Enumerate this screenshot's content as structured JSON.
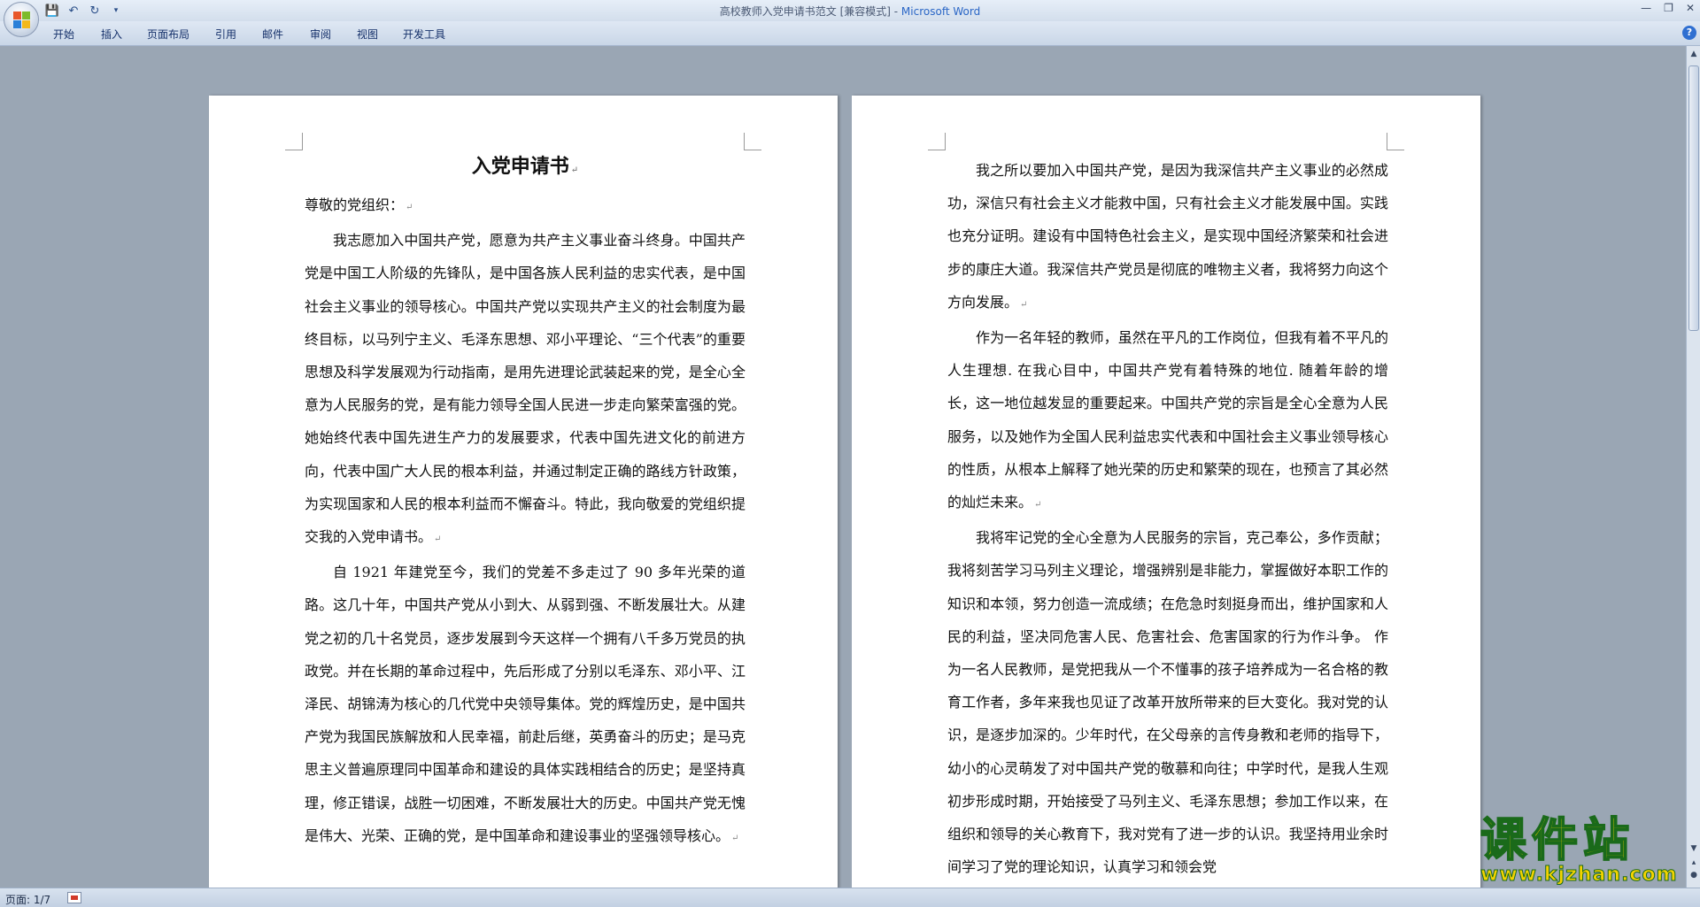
{
  "window": {
    "title": "高校教师入党申请书范文 [兼容模式] - ",
    "app_name": "Microsoft Word"
  },
  "quick_access": {
    "icons": [
      "save-icon",
      "undo-icon",
      "redo-icon",
      "customize-icon"
    ]
  },
  "ribbon_tabs": [
    "开始",
    "插入",
    "页面布局",
    "引用",
    "邮件",
    "审阅",
    "视图",
    "开发工具"
  ],
  "document": {
    "left_page": {
      "title": "入党申请书",
      "salutation": "尊敬的党组织：",
      "paragraphs": [
        "我志愿加入中国共产党，愿意为共产主义事业奋斗终身。中国共产党是中国工人阶级的先锋队，是中国各族人民利益的忠实代表，是中国社会主义事业的领导核心。中国共产党以实现共产主义的社会制度为最终目标，以马列宁主义、毛泽东思想、邓小平理论、“三个代表”的重要思想及科学发展观为行动指南，是用先进理论武装起来的党，是全心全意为人民服务的党，是有能力领导全国人民进一步走向繁荣富强的党。她始终代表中国先进生产力的发展要求，代表中国先进文化的前进方向，代表中国广大人民的根本利益，并通过制定正确的路线方针政策，为实现国家和人民的根本利益而不懈奋斗。特此，我向敬爱的党组织提交我的入党申请书。",
        "自 1921 年建党至今，我们的党差不多走过了 90 多年光荣的道路。这几十年，中国共产党从小到大、从弱到强、不断发展壮大。从建党之初的几十名党员，逐步发展到今天这样一个拥有八千多万党员的执政党。并在长期的革命过程中，先后形成了分别以毛泽东、邓小平、江泽民、胡锦涛为核心的几代党中央领导集体。党的辉煌历史，是中国共产党为我国民族解放和人民幸福，前赴后继，英勇奋斗的历史；是马克思主义普遍原理同中国革命和建设的具体实践相结合的历史；是坚持真理，修正错误，战胜一切困难，不断发展壮大的历史。中国共产党无愧是伟大、光荣、正确的党，是中国革命和建设事业的坚强领导核心。"
      ]
    },
    "right_page": {
      "paragraphs": [
        "我之所以要加入中国共产党，是因为我深信共产主义事业的必然成功，深信只有社会主义才能救中国，只有社会主义才能发展中国。实践也充分证明。建设有中国特色社会主义，是实现中国经济繁荣和社会进步的康庄大道。我深信共产党员是彻底的唯物主义者，我将努力向这个方向发展。",
        "作为一名年轻的教师，虽然在平凡的工作岗位，但我有着不平凡的人生理想. 在我心目中，中国共产党有着特殊的地位. 随着年龄的增长，这一地位越发显的重要起来。中国共产党的宗旨是全心全意为人民服务，以及她作为全国人民利益忠实代表和中国社会主义事业领导核心的性质，从根本上解释了她光荣的历史和繁荣的现在，也预言了其必然的灿烂未来。",
        "我将牢记党的全心全意为人民服务的宗旨，克己奉公，多作贡献；我将刻苦学习马列主义理论，增强辨别是非能力，掌握做好本职工作的知识和本领，努力创造一流成绩；在危急时刻挺身而出，维护国家和人民的利益，坚决同危害人民、危害社会、危害国家的行为作斗争。  作为一名人民教师，是党把我从一个不懂事的孩子培养成为一名合格的教育工作者，多年来我也见证了改革开放所带来的巨大变化。我对党的认识，是逐步加深的。少年时代，在父母亲的言传身教和老师的指导下，幼小的心灵萌发了对中国共产党的敬慕和向往；中学时代，是我人生观初步形成时期，开始接受了马列主义、毛泽东思想；参加工作以来，在组织和领导的关心教育下，我对党有了进一步的认识。我坚持用业余时间学习了党的理论知识，认真学习和领会党"
      ]
    }
  },
  "status_bar": {
    "page_info": "页面: 1/7"
  },
  "watermark": {
    "brand": "课件站",
    "url": "www.kjzhan.com"
  },
  "colors": {
    "workspace": "#9aa6b4",
    "title_accent": "#2a66c6",
    "watermark_fill": "#f4d300",
    "watermark_stroke": "#1a6a1a"
  }
}
